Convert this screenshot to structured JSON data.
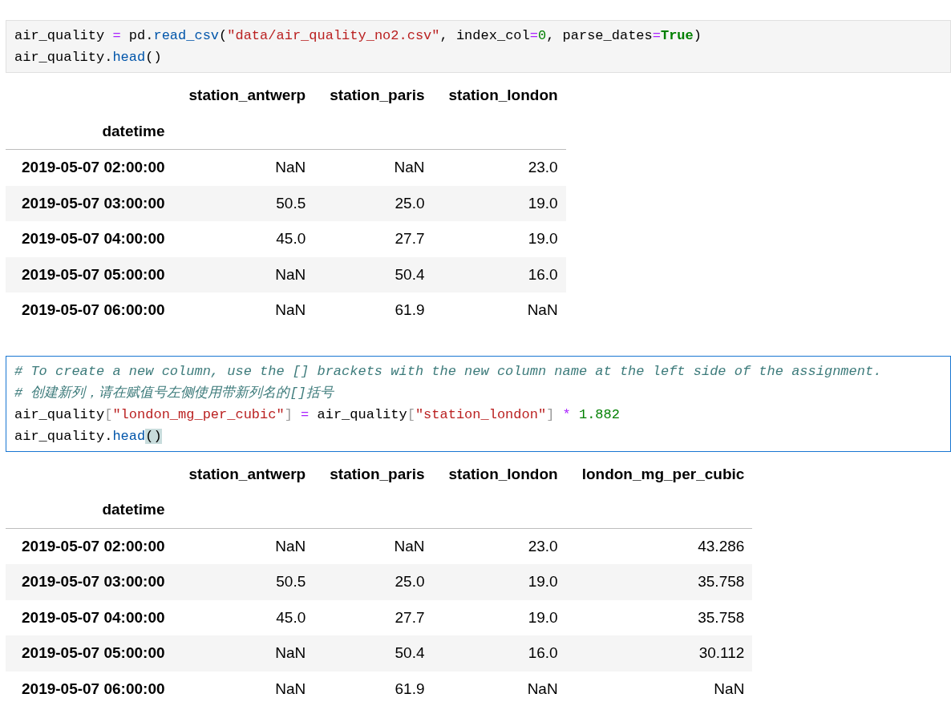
{
  "cells": [
    {
      "selected": false,
      "code": [
        [
          {
            "kind": "plain",
            "text": "air_quality "
          },
          {
            "kind": "op",
            "text": "="
          },
          {
            "kind": "plain",
            "text": " pd."
          },
          {
            "kind": "func",
            "text": "read_csv"
          },
          {
            "kind": "plain",
            "text": "("
          },
          {
            "kind": "str",
            "text": "\"data/air_quality_no2.csv\""
          },
          {
            "kind": "plain",
            "text": ", index_col"
          },
          {
            "kind": "op",
            "text": "="
          },
          {
            "kind": "num",
            "text": "0"
          },
          {
            "kind": "plain",
            "text": ", parse_dates"
          },
          {
            "kind": "op",
            "text": "="
          },
          {
            "kind": "kw",
            "text": "True"
          },
          {
            "kind": "plain",
            "text": ")"
          }
        ],
        [
          {
            "kind": "plain",
            "text": "air_quality."
          },
          {
            "kind": "func",
            "text": "head"
          },
          {
            "kind": "plain",
            "text": "()"
          }
        ]
      ],
      "output": {
        "columns": [
          "station_antwerp",
          "station_paris",
          "station_london"
        ],
        "index_name": "datetime",
        "rows": [
          {
            "index": "2019-05-07 02:00:00",
            "values": [
              "NaN",
              "NaN",
              "23.0"
            ]
          },
          {
            "index": "2019-05-07 03:00:00",
            "values": [
              "50.5",
              "25.0",
              "19.0"
            ]
          },
          {
            "index": "2019-05-07 04:00:00",
            "values": [
              "45.0",
              "27.7",
              "19.0"
            ]
          },
          {
            "index": "2019-05-07 05:00:00",
            "values": [
              "NaN",
              "50.4",
              "16.0"
            ]
          },
          {
            "index": "2019-05-07 06:00:00",
            "values": [
              "NaN",
              "61.9",
              "NaN"
            ]
          }
        ]
      }
    },
    {
      "selected": true,
      "code": [
        [
          {
            "kind": "comment",
            "text": "# To create a new column, use the [] brackets with the new column name at the left side of the assignment."
          }
        ],
        [
          {
            "kind": "comment",
            "text": "# 创建新列，请在赋值号左侧使用带新列名的[]括号"
          }
        ],
        [
          {
            "kind": "plain",
            "text": "air_quality"
          },
          {
            "kind": "bracket",
            "text": "["
          },
          {
            "kind": "str",
            "text": "\"london_mg_per_cubic\""
          },
          {
            "kind": "bracket",
            "text": "] "
          },
          {
            "kind": "op",
            "text": "="
          },
          {
            "kind": "plain",
            "text": " air_quality"
          },
          {
            "kind": "bracket",
            "text": "["
          },
          {
            "kind": "str",
            "text": "\"station_london\""
          },
          {
            "kind": "bracket",
            "text": "] "
          },
          {
            "kind": "op",
            "text": "* "
          },
          {
            "kind": "num",
            "text": "1.882"
          }
        ],
        [
          {
            "kind": "plain",
            "text": "air_quality."
          },
          {
            "kind": "func",
            "text": "head"
          },
          {
            "kind": "match",
            "text": "()"
          }
        ]
      ],
      "output": {
        "columns": [
          "station_antwerp",
          "station_paris",
          "station_london",
          "london_mg_per_cubic"
        ],
        "index_name": "datetime",
        "rows": [
          {
            "index": "2019-05-07 02:00:00",
            "values": [
              "NaN",
              "NaN",
              "23.0",
              "43.286"
            ]
          },
          {
            "index": "2019-05-07 03:00:00",
            "values": [
              "50.5",
              "25.0",
              "19.0",
              "35.758"
            ]
          },
          {
            "index": "2019-05-07 04:00:00",
            "values": [
              "45.0",
              "27.7",
              "19.0",
              "35.758"
            ]
          },
          {
            "index": "2019-05-07 05:00:00",
            "values": [
              "NaN",
              "50.4",
              "16.0",
              "30.112"
            ]
          },
          {
            "index": "2019-05-07 06:00:00",
            "values": [
              "NaN",
              "61.9",
              "NaN",
              "NaN"
            ]
          }
        ]
      }
    }
  ]
}
